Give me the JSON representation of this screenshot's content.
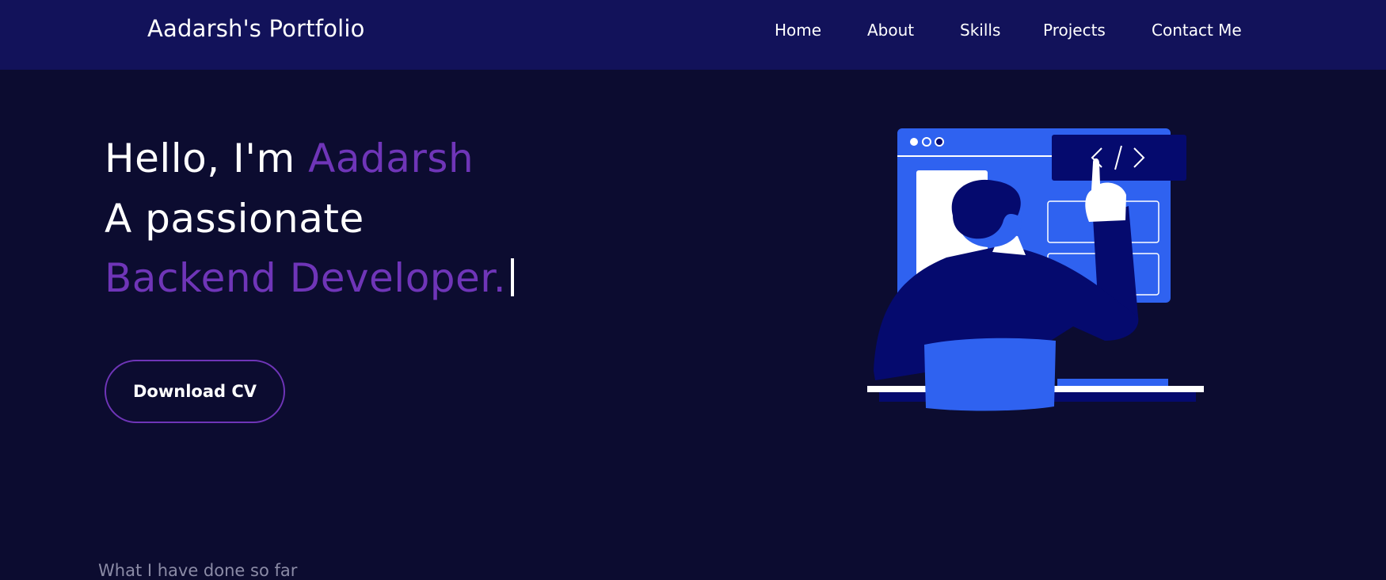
{
  "navbar": {
    "brand": "Aadarsh's Portfolio",
    "links": [
      {
        "label": "Home"
      },
      {
        "label": "About"
      },
      {
        "label": "Skills"
      },
      {
        "label": "Projects"
      },
      {
        "label": "Contact Me"
      }
    ]
  },
  "hero": {
    "greeting_prefix": "Hello, I'm",
    "name": "Aadarsh",
    "line2": "A passionate",
    "role": "Backend Developer.",
    "cv_button": "Download CV"
  },
  "next_section": {
    "heading": "What I have done so far"
  },
  "illustration": {
    "name": "developer-at-screen-illustration",
    "code_symbol": "</>"
  },
  "colors": {
    "background": "#0c0c30",
    "navbar": "#12125a",
    "accent": "#6f35b8",
    "illustration_blue": "#2f62f0",
    "illustration_navy": "#050a6e"
  }
}
